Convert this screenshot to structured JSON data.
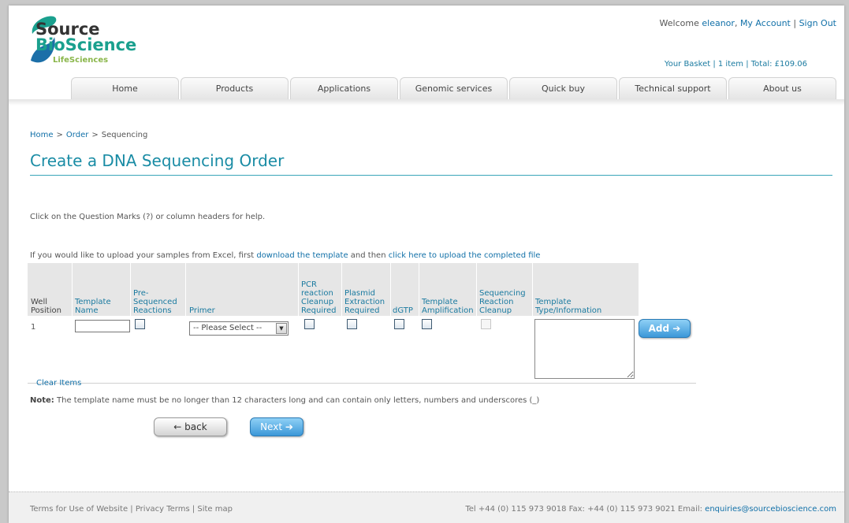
{
  "header": {
    "logo": {
      "source": "Source",
      "bioscience": "BioScience",
      "lifesciences": "LifeSciences"
    },
    "welcome_prefix": "Welcome ",
    "username": "eleanor",
    "my_account": "My Account",
    "sign_out": "Sign Out",
    "basket": "Your Basket | 1 item | Total: £109.06"
  },
  "nav": {
    "tabs": [
      "Home",
      "Products",
      "Applications",
      "Genomic services",
      "Quick buy",
      "Technical support",
      "About us"
    ]
  },
  "breadcrumb": {
    "home": "Home",
    "order": "Order",
    "current": "Sequencing",
    "separator": ">"
  },
  "page_title": "Create a DNA Sequencing Order",
  "help_text": "Click on the Question Marks (?) or column headers for help.",
  "upload": {
    "prefix": "If you would like to upload your samples from Excel, first ",
    "download_link": "download the template",
    "middle": " and then ",
    "upload_link": "click here to upload the completed file"
  },
  "table": {
    "columns": {
      "well_position": [
        "Well",
        "Position"
      ],
      "template_name": [
        "Template",
        "Name"
      ],
      "pre_sequenced": [
        "Pre-",
        "Sequenced",
        "Reactions"
      ],
      "primer": [
        "Primer"
      ],
      "pcr_cleanup": [
        "PCR",
        "reaction",
        "Cleanup",
        "Required"
      ],
      "plasmid_extraction": [
        "Plasmid",
        "Extraction",
        "Required"
      ],
      "dgtp": [
        "dGTP"
      ],
      "template_amplification": [
        "Template",
        "Amplification"
      ],
      "sequencing_cleanup": [
        "Sequencing",
        "Reaction",
        "Cleanup"
      ],
      "template_type": [
        "Template",
        "Type/Information"
      ]
    },
    "row": {
      "well": "1",
      "template_name_value": "",
      "primer_selected": "-- Please Select --"
    },
    "add_button": "Add ➔"
  },
  "clear_items": "Clear Items",
  "note": {
    "label": "Note:",
    "text": " The template name must be no longer than 12 characters long and can contain only letters, numbers and underscores (_)"
  },
  "buttons": {
    "back": "← back",
    "next": "Next ➔"
  },
  "footer": {
    "left": "Terms for Use of Website | Privacy Terms | Site map",
    "right_prefix": "Tel +44 (0) 115 973 9018 Fax: +44 (0) 115 973 9021 Email: ",
    "email": "enquiries@sourcebioscience.com"
  },
  "colors": {
    "accent": "#1a8ca5",
    "link": "#1170a8",
    "button_blue": "#3c98d8"
  }
}
